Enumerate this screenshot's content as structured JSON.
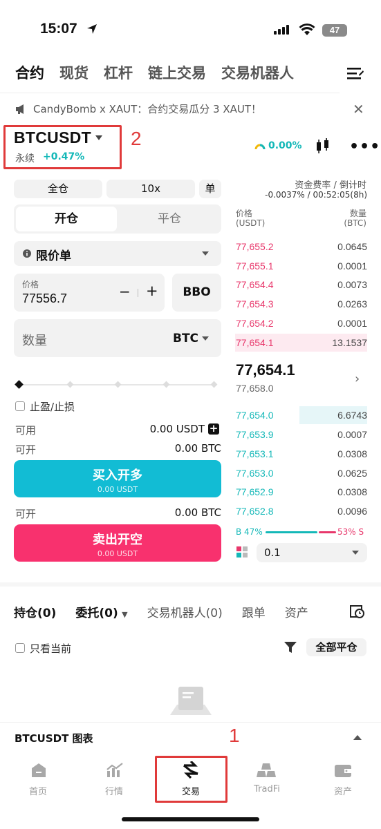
{
  "status": {
    "time": "15:07",
    "battery": "47"
  },
  "tabs": [
    "合约",
    "现货",
    "杠杆",
    "链上交易",
    "交易机器人"
  ],
  "banner": "CandyBomb x XAUT：合约交易瓜分 3 XAUT！",
  "symbol": {
    "name": "BTCUSDT",
    "type": "永续",
    "change": "+0.47%",
    "funding_display": "0.00%"
  },
  "annotations": {
    "label1": "1",
    "label2": "2"
  },
  "controls": {
    "margin_mode": "全仓",
    "leverage": "10x",
    "single": "单"
  },
  "position_tabs": {
    "open": "开仓",
    "close": "平仓"
  },
  "order_type": "限价单",
  "price": {
    "label": "价格",
    "value": "77556.7",
    "minus": "−",
    "plus": "+",
    "bbo": "BBO"
  },
  "quantity": {
    "label": "数量",
    "unit": "BTC"
  },
  "slider": {
    "level": 0
  },
  "tpsl": "止盈/止损",
  "available": {
    "label": "可用",
    "value": "0.00 USDT"
  },
  "can_open_long": {
    "label": "可开",
    "value": "0.00 BTC"
  },
  "buy": {
    "label": "买入开多",
    "sub": "0.00 USDT"
  },
  "can_open_short": {
    "label": "可开",
    "value": "0.00 BTC"
  },
  "sell": {
    "label": "卖出开空",
    "sub": "0.00 USDT"
  },
  "orderbook": {
    "funding_title": "资金费率 / 倒计时",
    "funding_value": "-0.0037% / 00:52:05(8h)",
    "col_price": "价格",
    "col_price_unit": "(USDT)",
    "col_qty": "数量",
    "col_qty_unit": "(BTC)",
    "asks": [
      {
        "price": "77,655.2",
        "qty": "0.0645"
      },
      {
        "price": "77,655.1",
        "qty": "0.0001"
      },
      {
        "price": "77,654.4",
        "qty": "0.0073"
      },
      {
        "price": "77,654.3",
        "qty": "0.0263"
      },
      {
        "price": "77,654.2",
        "qty": "0.0001"
      },
      {
        "price": "77,654.1",
        "qty": "13.1537"
      }
    ],
    "last_price": "77,654.1",
    "mark_price": "77,658.0",
    "bids": [
      {
        "price": "77,654.0",
        "qty": "6.6743"
      },
      {
        "price": "77,653.9",
        "qty": "0.0007"
      },
      {
        "price": "77,653.1",
        "qty": "0.0308"
      },
      {
        "price": "77,653.0",
        "qty": "0.0625"
      },
      {
        "price": "77,652.9",
        "qty": "0.0308"
      },
      {
        "price": "77,652.8",
        "qty": "0.0096"
      }
    ],
    "buy_ratio": "B 47%",
    "sell_ratio": "53% S",
    "precision": "0.1"
  },
  "bottom_tabs": [
    "持仓(0)",
    "委托(0)",
    "交易机器人(0)",
    "跟单",
    "资产"
  ],
  "only_current": "只看当前",
  "close_all": "全部平仓",
  "chart_bar": "BTCUSDT 图表",
  "nav": [
    "首页",
    "行情",
    "交易",
    "TradFi",
    "资产"
  ],
  "colors": {
    "buy": "#12bcd4",
    "sell": "#f8316e",
    "accent": "#14b8b8",
    "annotation": "#e03a3a"
  }
}
